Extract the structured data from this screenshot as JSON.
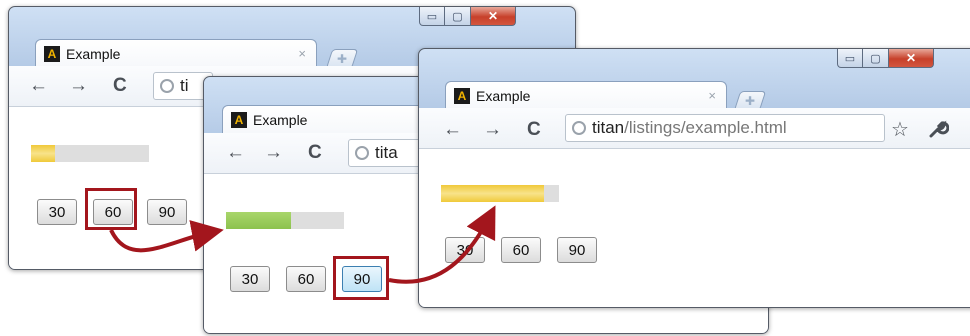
{
  "window_controls": {
    "minimize": "▭",
    "maximize": "▢",
    "close": "✕"
  },
  "tab": {
    "title": "Example",
    "close": "×",
    "favicon_letter": "A",
    "newtab_icon": "plus-icon"
  },
  "nav": {
    "back": "←",
    "forward": "→",
    "reload": "C"
  },
  "address_fragments": {
    "win1": "ti",
    "win2": "tita"
  },
  "address": {
    "host": "titan",
    "path": "/listings/example.html"
  },
  "toolbar_icons": {
    "star": "☆",
    "wrench": "wrench-icon"
  },
  "buttons": [
    "30",
    "60",
    "90"
  ],
  "progress": {
    "win1": 0.2,
    "win2": 0.55,
    "win3": 0.87
  },
  "colors": {
    "yellow_fill": "#f0c93a",
    "green_fill": "#8cc24e",
    "highlight": "#a3161d",
    "arrow": "#a3161d"
  }
}
